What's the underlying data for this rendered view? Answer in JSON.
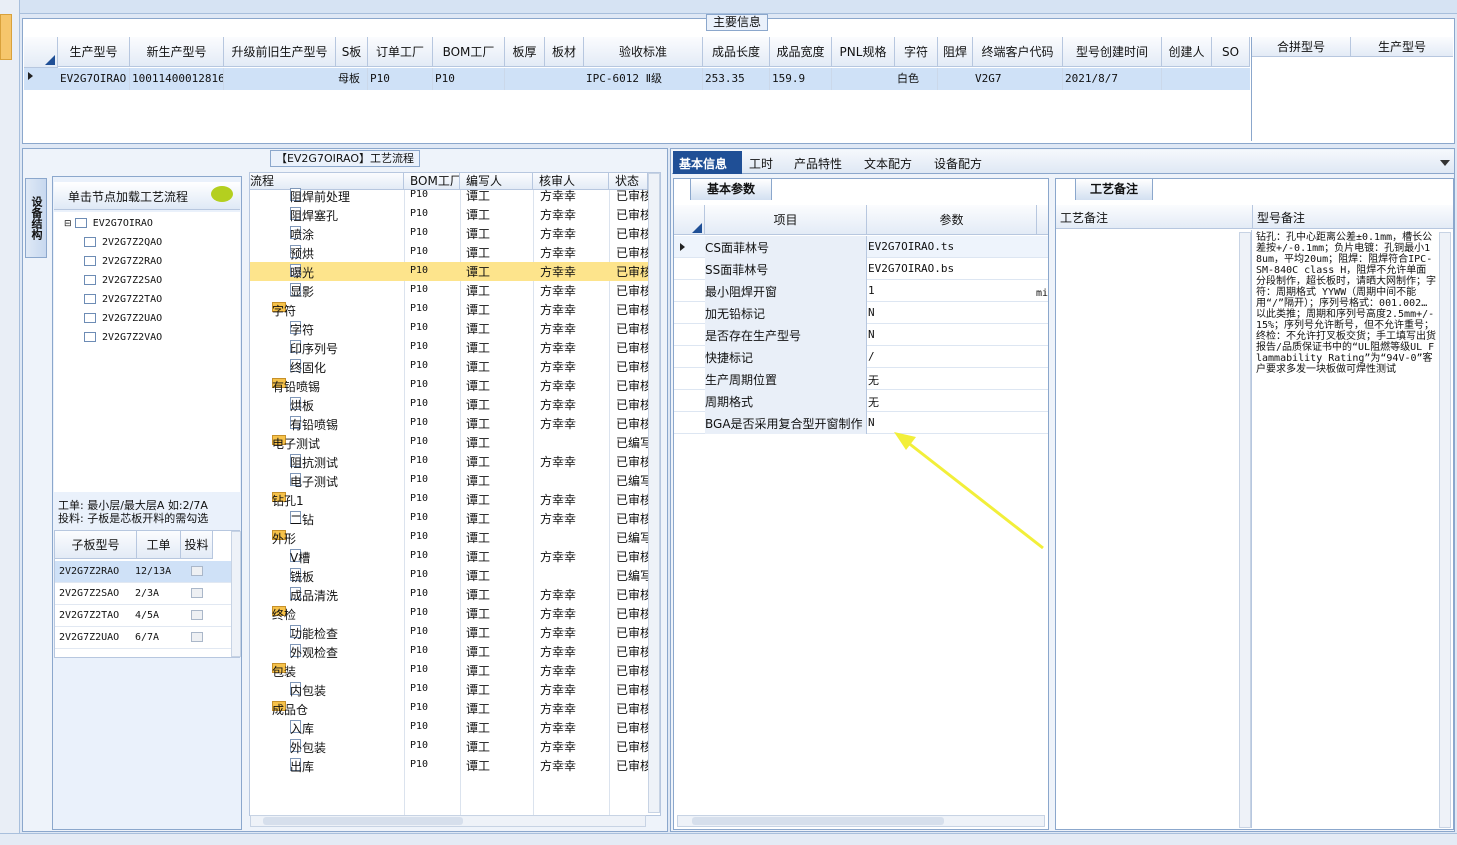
{
  "main": {
    "title": "主要信息",
    "columns": [
      "生产型号",
      "新生产型号",
      "升级前旧生产型号",
      "S板",
      "订单工厂",
      "BOM工厂",
      "板厚",
      "板材",
      "验收标准",
      "成品长度",
      "成品宽度",
      "PNL规格",
      "字符",
      "阻焊",
      "终端客户代码",
      "型号创建时间",
      "创建人",
      "SO"
    ],
    "row": {
      "c0": "EV2G7OIRAO",
      "c1": "10011400012816",
      "c3": "母板",
      "c4": "P10",
      "c5": "P10",
      "c8": "IPC-6012 Ⅱ级",
      "c9": "253.35",
      "c10": "159.9",
      "c12": "白色",
      "c14": "V2G7",
      "c15": "2021/8/7"
    },
    "right_columns": [
      "合拼型号",
      "生产型号"
    ]
  },
  "process": {
    "title": "【EV2G7OIRAO】工艺流程",
    "side_tab": "设备结构",
    "load_hint": "单击节点加载工艺流程",
    "tree_root": "EV2G7OIRAO",
    "tree_children": [
      "2V2G7Z2QAO",
      "2V2G7Z2RAO",
      "2V2G7Z2SAO",
      "2V2G7Z2TAO",
      "2V2G7Z2UAO",
      "2V2G7Z2VAO"
    ],
    "info1": "工单: 最小层/最大层A 如:2/7A",
    "info2": "投料: 子板是芯板开料的需勾选",
    "sub_headers": [
      "子板型号",
      "工单",
      "投料"
    ],
    "sub_rows": [
      {
        "model": "2V2G7Z2RAO",
        "order": "12/13A"
      },
      {
        "model": "2V2G7Z2SAO",
        "order": "2/3A"
      },
      {
        "model": "2V2G7Z2TAO",
        "order": "4/5A"
      },
      {
        "model": "2V2G7Z2UAO",
        "order": "6/7A"
      }
    ],
    "flow_headers": [
      "流程",
      "BOM工厂",
      "编写人",
      "核审人",
      "状态"
    ],
    "flow_rows": [
      {
        "name": "阻焊前处理",
        "bom": "P10",
        "writer": "谭工",
        "reviewer": "方幸幸",
        "status": "已审核",
        "level": 2
      },
      {
        "name": "阻焊塞孔",
        "bom": "P10",
        "writer": "谭工",
        "reviewer": "方幸幸",
        "status": "已审核",
        "level": 2
      },
      {
        "name": "喷涂",
        "bom": "P10",
        "writer": "谭工",
        "reviewer": "方幸幸",
        "status": "已审核",
        "level": 2
      },
      {
        "name": "预烘",
        "bom": "P10",
        "writer": "谭工",
        "reviewer": "方幸幸",
        "status": "已审核",
        "level": 2
      },
      {
        "name": "曝光",
        "bom": "P10",
        "writer": "谭工",
        "reviewer": "方幸幸",
        "status": "已审核",
        "level": 2,
        "selected": true
      },
      {
        "name": "显影",
        "bom": "P10",
        "writer": "谭工",
        "reviewer": "方幸幸",
        "status": "已审核",
        "level": 2
      },
      {
        "name": "字符",
        "bom": "P10",
        "writer": "谭工",
        "reviewer": "方幸幸",
        "status": "已审核",
        "level": 1
      },
      {
        "name": "字符",
        "bom": "P10",
        "writer": "谭工",
        "reviewer": "方幸幸",
        "status": "已审核",
        "level": 2
      },
      {
        "name": "印序列号",
        "bom": "P10",
        "writer": "谭工",
        "reviewer": "方幸幸",
        "status": "已审核",
        "level": 2
      },
      {
        "name": "终固化",
        "bom": "P10",
        "writer": "谭工",
        "reviewer": "方幸幸",
        "status": "已审核",
        "level": 2
      },
      {
        "name": "有铅喷锡",
        "bom": "P10",
        "writer": "谭工",
        "reviewer": "方幸幸",
        "status": "已审核",
        "level": 1
      },
      {
        "name": "烘板",
        "bom": "P10",
        "writer": "谭工",
        "reviewer": "方幸幸",
        "status": "已审核",
        "level": 2
      },
      {
        "name": "有铅喷锡",
        "bom": "P10",
        "writer": "谭工",
        "reviewer": "方幸幸",
        "status": "已审核",
        "level": 2
      },
      {
        "name": "电子测试",
        "bom": "P10",
        "writer": "谭工",
        "reviewer": "",
        "status": "已编写",
        "level": 1
      },
      {
        "name": "阻抗测试",
        "bom": "P10",
        "writer": "谭工",
        "reviewer": "方幸幸",
        "status": "已审核",
        "level": 2
      },
      {
        "name": "电子测试",
        "bom": "P10",
        "writer": "谭工",
        "reviewer": "",
        "status": "已编写",
        "level": 2
      },
      {
        "name": "钻孔1",
        "bom": "P10",
        "writer": "谭工",
        "reviewer": "方幸幸",
        "status": "已审核",
        "level": 1
      },
      {
        "name": "二钻",
        "bom": "P10",
        "writer": "谭工",
        "reviewer": "方幸幸",
        "status": "已审核",
        "level": 2
      },
      {
        "name": "外形",
        "bom": "P10",
        "writer": "谭工",
        "reviewer": "",
        "status": "已编写",
        "level": 1
      },
      {
        "name": "V槽",
        "bom": "P10",
        "writer": "谭工",
        "reviewer": "方幸幸",
        "status": "已审核",
        "level": 2
      },
      {
        "name": "铣板",
        "bom": "P10",
        "writer": "谭工",
        "reviewer": "",
        "status": "已编写",
        "level": 2
      },
      {
        "name": "成品清洗",
        "bom": "P10",
        "writer": "谭工",
        "reviewer": "方幸幸",
        "status": "已审核",
        "level": 2
      },
      {
        "name": "终检",
        "bom": "P10",
        "writer": "谭工",
        "reviewer": "方幸幸",
        "status": "已审核",
        "level": 1
      },
      {
        "name": "功能检查",
        "bom": "P10",
        "writer": "谭工",
        "reviewer": "方幸幸",
        "status": "已审核",
        "level": 2
      },
      {
        "name": "外观检查",
        "bom": "P10",
        "writer": "谭工",
        "reviewer": "方幸幸",
        "status": "已审核",
        "level": 2
      },
      {
        "name": "包装",
        "bom": "P10",
        "writer": "谭工",
        "reviewer": "方幸幸",
        "status": "已审核",
        "level": 1
      },
      {
        "name": "内包装",
        "bom": "P10",
        "writer": "谭工",
        "reviewer": "方幸幸",
        "status": "已审核",
        "level": 2
      },
      {
        "name": "成品仓",
        "bom": "P10",
        "writer": "谭工",
        "reviewer": "方幸幸",
        "status": "已审核",
        "level": 1
      },
      {
        "name": "入库",
        "bom": "P10",
        "writer": "谭工",
        "reviewer": "方幸幸",
        "status": "已审核",
        "level": 2
      },
      {
        "name": "外包装",
        "bom": "P10",
        "writer": "谭工",
        "reviewer": "方幸幸",
        "status": "已审核",
        "level": 2
      },
      {
        "name": "出库",
        "bom": "P10",
        "writer": "谭工",
        "reviewer": "方幸幸",
        "status": "已审核",
        "level": 2
      }
    ]
  },
  "tabs": [
    "基本信息",
    "工时",
    "产品特性",
    "文本配方",
    "设备配方"
  ],
  "basic": {
    "title": "基本参数",
    "headers": [
      "项目",
      "参数"
    ],
    "rows": [
      {
        "k": "CS面菲林号",
        "v": "EV2G7OIRAO.ts"
      },
      {
        "k": "SS面菲林号",
        "v": "EV2G7OIRAO.bs"
      },
      {
        "k": "最小阻焊开窗",
        "v": "1"
      },
      {
        "k": "加无铅标记",
        "v": "N"
      },
      {
        "k": "是否存在生产型号",
        "v": "N"
      },
      {
        "k": "快捷标记",
        "v": "/"
      },
      {
        "k": "生产周期位置",
        "v": "无"
      },
      {
        "k": "周期格式",
        "v": "无"
      },
      {
        "k": "BGA是否采用复合型开窗制作",
        "v": "N"
      }
    ],
    "unit_cut": "mi"
  },
  "notes": {
    "title": "工艺备注",
    "headers": [
      "工艺备注",
      "型号备注"
    ],
    "model_note": "钻孔：孔中心距离公差±0.1mm，槽长公差按+/-0.1mm；负片电镀：孔铜最小18um，平均20um；阻焊：阻焊符合IPC-SM-840C class H，阻焊不允许单面分段制作，超长板时，请晒大网制作；字符：周期格式 YYWW（周期中间不能用“/”隔开）；序列号格式：001.002…以此类推；周期和序列号高度2.5mm+/-15%；序列号允许断号，但不允许重号；终检：不允许打叉板交货；手工填写出货报告/品质保证书中的“UL阻燃等级UL Flammability Rating”为“94V-0”客户要求多发一块板做可焊性测试"
  },
  "colors": {
    "selected_row": "#fde48c",
    "accent": "#1f4f96",
    "arrow": "#f2ef3a"
  }
}
